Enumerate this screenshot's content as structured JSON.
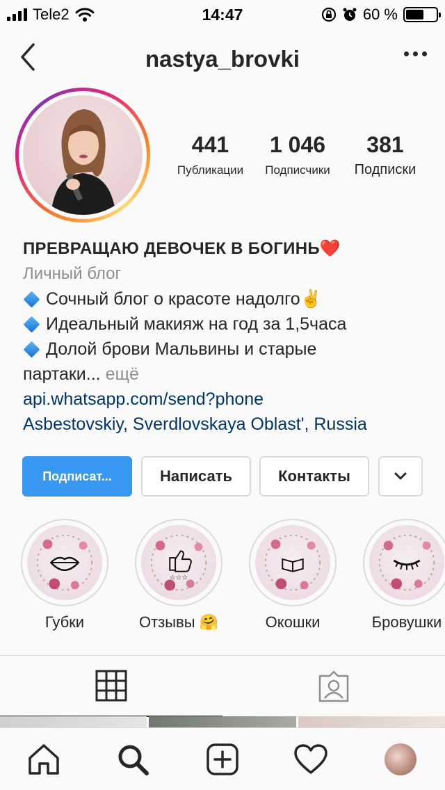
{
  "status_bar": {
    "carrier": "Tele2",
    "time": "14:47",
    "battery_percent": "60 %",
    "battery_level": 0.6
  },
  "header": {
    "username": "nastya_brovki"
  },
  "stats": [
    {
      "value": "441",
      "label": "Публикации"
    },
    {
      "value": "1 046",
      "label": "Подписчики"
    },
    {
      "value": "381",
      "label": "Подписки"
    }
  ],
  "bio": {
    "name": "ПРЕВРАЩАЮ ДЕВОЧЕК В БОГИНЬ❤️",
    "category": "Личный блог",
    "lines": [
      "Сочный блог о красоте надолго✌️",
      "Идеальный макияж на год за 1,5часа",
      "Долой брови Мальвины и старые"
    ],
    "line4": "партаки...",
    "more": "ещё",
    "link": "api.whatsapp.com/send?phone",
    "location": "Asbestovskiy, Sverdlovskaya Oblast', Russia"
  },
  "buttons": {
    "follow": "Подписат...",
    "message": "Написать",
    "contacts": "Контакты"
  },
  "highlights": [
    {
      "label": "Губки",
      "icon": "lips-icon"
    },
    {
      "label": "Отзывы 🤗",
      "icon": "thumbs-up-icon"
    },
    {
      "label": "Окошки",
      "icon": "book-icon"
    },
    {
      "label": "Бровушки",
      "icon": "eyelash-icon"
    }
  ],
  "colors": {
    "accent": "#3897f0",
    "link": "#003569",
    "muted": "#8e8e8e"
  }
}
